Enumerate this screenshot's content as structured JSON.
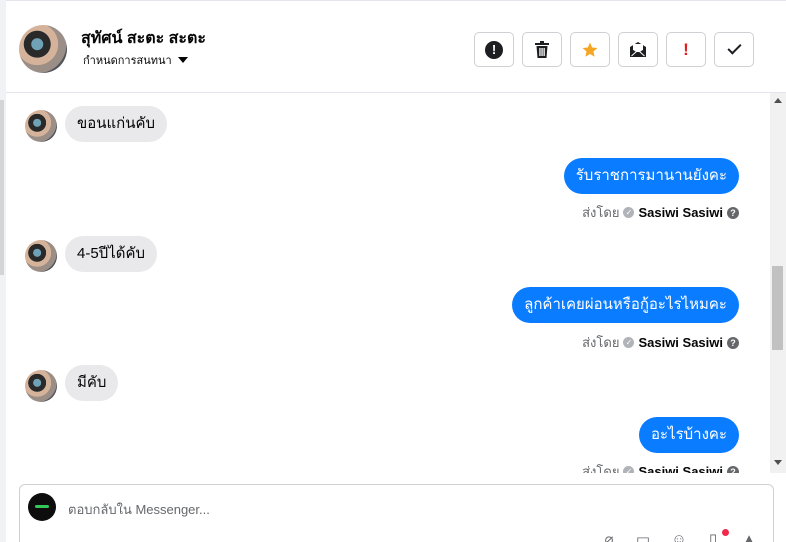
{
  "header": {
    "contact_name": "สุทัศน์ สะตะ สะตะ",
    "assign_label": "กำหนดการสนทนา"
  },
  "toolbar": {
    "buttons": [
      {
        "name": "spam-button",
        "icon": "exclamation-circle-icon"
      },
      {
        "name": "delete-button",
        "icon": "trash-icon"
      },
      {
        "name": "star-button",
        "icon": "star-icon",
        "color": "#f5a623"
      },
      {
        "name": "unread-button",
        "icon": "envelope-icon"
      },
      {
        "name": "important-button",
        "icon": "exclamation-icon",
        "label": "!",
        "color": "#e02020"
      },
      {
        "name": "done-button",
        "icon": "check-icon"
      }
    ]
  },
  "messages": [
    {
      "direction": "in",
      "text": "ขอนแก่นคับ"
    },
    {
      "direction": "out",
      "text": "รับราชการมานานยังคะ",
      "sent_label": "ส่งโดย",
      "sender": "Sasiwi Sasiwi"
    },
    {
      "direction": "in",
      "text": "4-5ปีได้คับ"
    },
    {
      "direction": "out",
      "text": "ลูกค้าเคยผ่อนหรือกู้อะไรไหมคะ",
      "sent_label": "ส่งโดย",
      "sender": "Sasiwi Sasiwi"
    },
    {
      "direction": "in",
      "text": "มีคับ"
    },
    {
      "direction": "out",
      "text": "อะไรบ้างคะ",
      "sent_label": "ส่งโดย",
      "sender": "Sasiwi Sasiwi"
    }
  ],
  "composer": {
    "placeholder": "ตอบกลับใน Messenger...",
    "icons": [
      "paperclip-icon",
      "gif-icon",
      "emoji-icon",
      "sticker-icon",
      "like-icon"
    ]
  },
  "colors": {
    "outgoing_bubble": "#0a7cff",
    "incoming_bubble": "#e9e9eb",
    "star": "#f5a623",
    "notification_dot": "#f02849"
  }
}
